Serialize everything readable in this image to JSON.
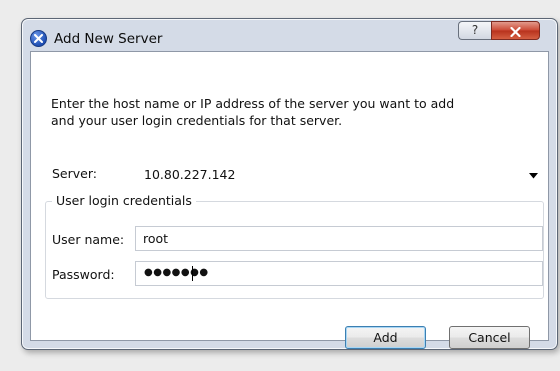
{
  "window": {
    "title": "Add New Server",
    "help_label": "?"
  },
  "dialog": {
    "intro_line1": "Enter the host name or IP address of the server you want to add",
    "intro_line2": "and your user login credentials for that server.",
    "server": {
      "label": "Server:",
      "value": "10.80.227.142"
    },
    "credentials": {
      "group_title": "User login credentials",
      "username_label": "User name:",
      "username_value": "root",
      "password_label": "Password:",
      "password_masked": "●●●●●●●"
    },
    "buttons": {
      "add": "Add",
      "cancel": "Cancel"
    }
  },
  "icons": {
    "app": "x-logo-icon",
    "help": "help-icon",
    "close": "close-icon",
    "dropdown": "chevron-down-icon"
  },
  "colors": {
    "frame": "#d4dbe7",
    "close_button": "#c94630",
    "default_button_border": "#3c7fb1"
  }
}
